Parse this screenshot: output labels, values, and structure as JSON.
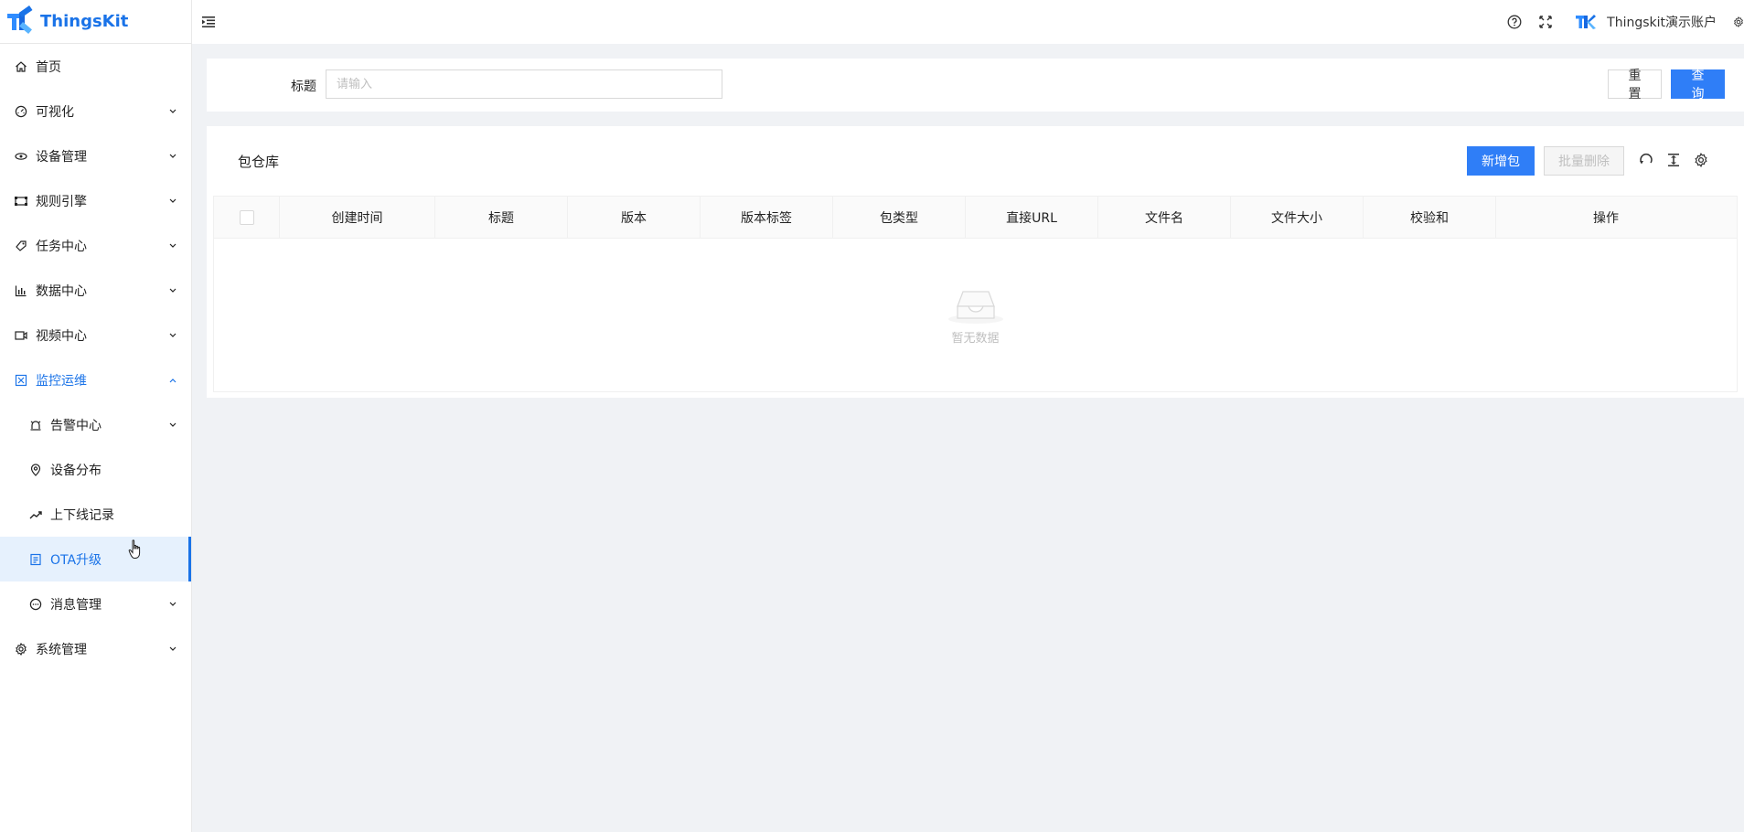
{
  "app": {
    "name": "ThingsKit",
    "brand_color": "#1a73e8"
  },
  "sidebar": {
    "items": [
      {
        "label": "首页",
        "icon": "home-icon",
        "has_chevron": false
      },
      {
        "label": "可视化",
        "icon": "dashboard-icon",
        "has_chevron": true
      },
      {
        "label": "设备管理",
        "icon": "device-icon",
        "has_chevron": true
      },
      {
        "label": "规则引擎",
        "icon": "rule-engine-icon",
        "has_chevron": true
      },
      {
        "label": "任务中心",
        "icon": "task-icon",
        "has_chevron": true
      },
      {
        "label": "数据中心",
        "icon": "bar-chart-icon",
        "has_chevron": true
      },
      {
        "label": "视频中心",
        "icon": "video-icon",
        "has_chevron": true
      },
      {
        "label": "监控运维",
        "icon": "monitor-icon",
        "has_chevron": true,
        "open": true
      },
      {
        "label": "告警中心",
        "icon": "alarm-icon",
        "has_chevron": true,
        "sub": true
      },
      {
        "label": "设备分布",
        "icon": "location-icon",
        "has_chevron": false,
        "sub": true
      },
      {
        "label": "上下线记录",
        "icon": "trend-icon",
        "has_chevron": false,
        "sub": true
      },
      {
        "label": "OTA升级",
        "icon": "ota-icon",
        "has_chevron": false,
        "sub": true,
        "selected": true
      },
      {
        "label": "消息管理",
        "icon": "message-icon",
        "has_chevron": true,
        "sub": true
      },
      {
        "label": "系统管理",
        "icon": "settings-icon",
        "has_chevron": true
      }
    ]
  },
  "header": {
    "account_name": "Thingskit演示账户"
  },
  "search": {
    "label": "标题",
    "placeholder": "请输入",
    "value": "",
    "reset_label": "重置",
    "query_label": "查询"
  },
  "table": {
    "title": "包仓库",
    "add_label": "新增包",
    "batch_delete_label": "批量删除",
    "columns": [
      "创建时间",
      "标题",
      "版本",
      "版本标签",
      "包类型",
      "直接URL",
      "文件名",
      "文件大小",
      "校验和",
      "操作"
    ],
    "rows": [],
    "empty_text": "暂无数据"
  }
}
